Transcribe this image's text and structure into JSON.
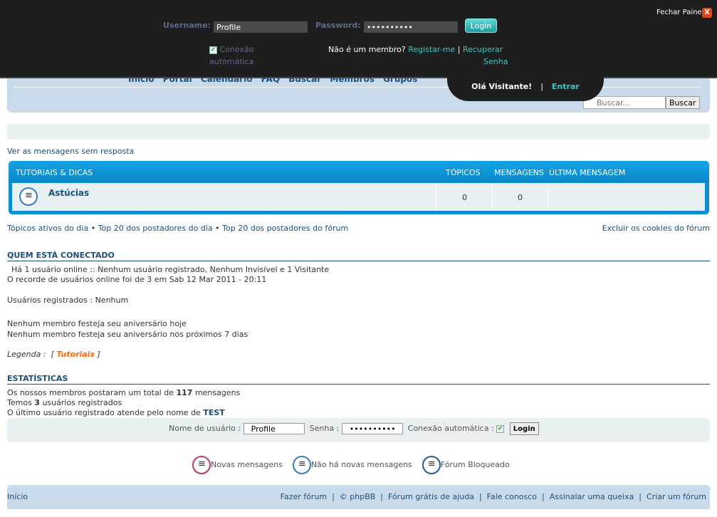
{
  "panel": {
    "username_label": "Username:",
    "username_value": "Profile",
    "password_label": "Password:",
    "password_value": "••••••••••",
    "login": "Login",
    "auto_login_1": "Conexão",
    "auto_login_2": "automática",
    "not_member": "Não é um membro?",
    "register": "Registar-me",
    "sep": "|",
    "recover_1": "Recuperar",
    "recover_2": "Senha",
    "close": "Fechar Painel",
    "hello": "Olá Visitante!",
    "enter": "Entrar"
  },
  "nav": {
    "items": [
      "Início",
      "Portal",
      "Calendário",
      "FAQ",
      "Buscar",
      "Membros",
      "Grupos"
    ]
  },
  "search": {
    "placeholder": "Buscar...",
    "button": "Buscar"
  },
  "unanswered": "Ver as mensagens sem resposta",
  "category": {
    "title": "TUTORIAIS & DICAS",
    "col_topics": "TÓPICOS",
    "col_posts": "MENSAGENS",
    "col_last": "ÚLTIMA MENSAGEM",
    "forums": [
      {
        "name": "Astúcias",
        "topics": "0",
        "posts": "0",
        "last": ""
      }
    ]
  },
  "links": {
    "active": "Tópicos ativos do dia",
    "top_day": "Top 20 dos postadores do dia",
    "top_forum": "Top 20 dos postadores do fórum",
    "bullet": "•",
    "cookies": "Excluir os cookies do fórum"
  },
  "who": {
    "title": "QUEM ESTÁ CONECTADO",
    "online": "Há 1 usuário online :: Nenhum usuário registrado, Nenhum Invisível e 1 Visitante",
    "record": "O recorde de usuários online foi de 3 em Sab 12 Mar 2011 - 20:11",
    "registered": "Usuários registrados : Nenhum",
    "birthday_today": "Nenhum membro festeja seu aniversário hoje",
    "birthday_week": "Nenhum membro festeja seu aniversário nos próximos 7 dias",
    "legend_label": "Legenda :",
    "legend_group": "Tutoriais"
  },
  "stats": {
    "title": "ESTATÍSTICAS",
    "posts_pre": "Os nossos membros postaram um total de",
    "posts": "117",
    "posts_post": "mensagens",
    "users_pre": "Temos",
    "users": "3",
    "users_post": "usuários registrados",
    "last_pre": "O último usuário registrado atende pelo nome de",
    "last_user": "TEST"
  },
  "quicklogin": {
    "user_label": "Nome de usuário :",
    "user_value": "Profile",
    "pass_label": "Senha :",
    "pass_value": "••••••••••",
    "auto": "Conexão automática :",
    "login": "Login"
  },
  "legend": {
    "new": "Novas mensagens",
    "no_new": "Não há novas mensagens",
    "locked": "Fórum Bloqueado"
  },
  "footer": {
    "home": "Início",
    "links": [
      "Fazer fórum",
      "© phpBB",
      "Fórum grátis de ajuda",
      "Fale conosco",
      "Assinalar uma queixa",
      "Criar um fórum"
    ]
  },
  "colors": {
    "accent": "#1c4e7a",
    "teal": "#3ec6c6",
    "category": "#0b8fd1",
    "legend_group": "#ff6600"
  }
}
